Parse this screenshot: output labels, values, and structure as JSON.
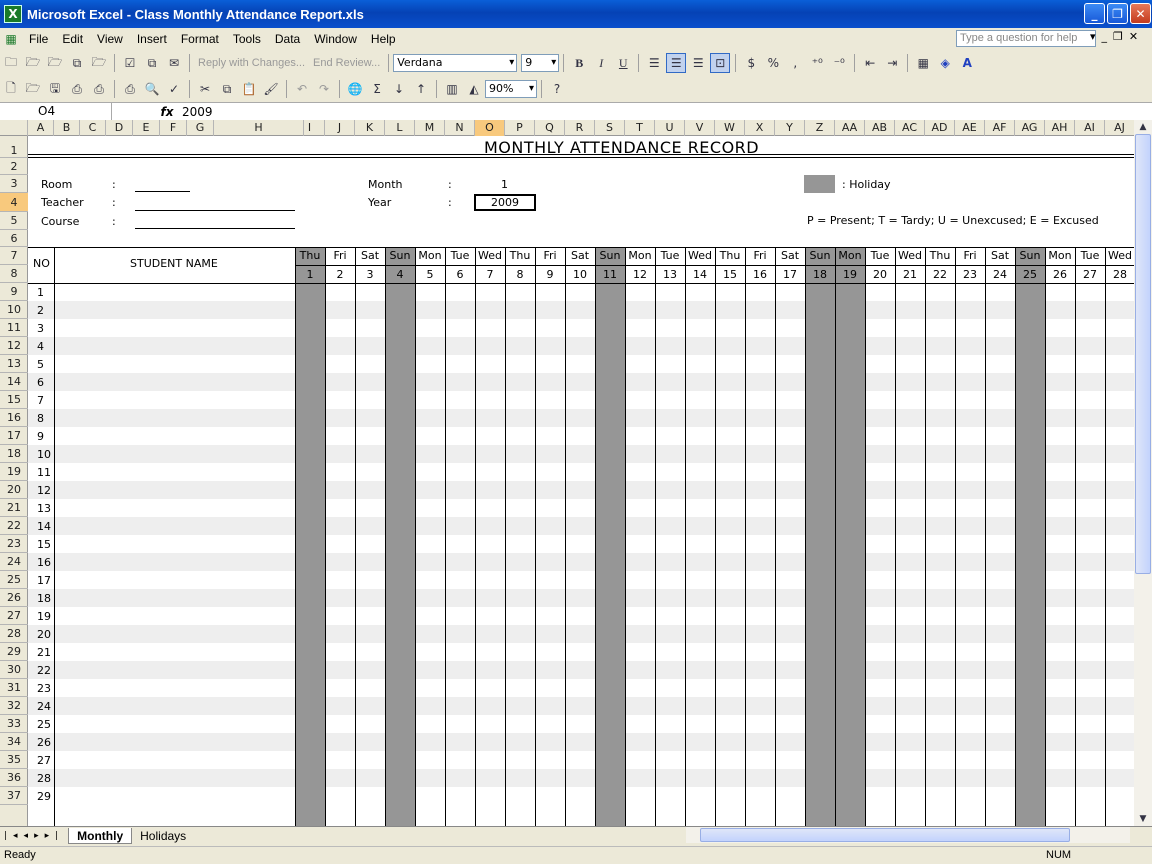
{
  "window": {
    "title": "Microsoft Excel - Class Monthly Attendance Report.xls",
    "min": "_",
    "restore": "❐",
    "close": "✕"
  },
  "menu": [
    "File",
    "Edit",
    "View",
    "Insert",
    "Format",
    "Tools",
    "Data",
    "Window",
    "Help"
  ],
  "help_placeholder": "Type a question for help",
  "toolbar": {
    "reply": "Reply with Changes...",
    "end_review": "End Review...",
    "font": "Verdana",
    "size": "9",
    "zoom": "90%",
    "bold": "B",
    "italic": "I",
    "underline": "U",
    "currency": "$",
    "percent": "%",
    "comma": ","
  },
  "formula": {
    "namebox": "O4",
    "fx": "fx",
    "value": "2009"
  },
  "columns": [
    "A",
    "B",
    "C",
    "D",
    "E",
    "F",
    "G",
    "H",
    "I",
    "J",
    "K",
    "L",
    "M",
    "N",
    "O",
    "P",
    "Q",
    "R",
    "S",
    "T",
    "U",
    "V",
    "W",
    "X",
    "Y",
    "Z",
    "AA",
    "AB",
    "AC",
    "AD",
    "AE",
    "AF",
    "AG",
    "AH",
    "AI",
    "AJ"
  ],
  "rows": [
    "1",
    "2",
    "3",
    "4",
    "5",
    "6",
    "7",
    "8",
    "9",
    "10",
    "11",
    "12",
    "13",
    "14",
    "15",
    "16",
    "17",
    "18",
    "19",
    "20",
    "21",
    "22",
    "23",
    "24",
    "25",
    "26",
    "27",
    "28",
    "29",
    "30",
    "31",
    "32",
    "33",
    "34",
    "35",
    "36",
    "37"
  ],
  "sheet": {
    "title": "MONTHLY ATTENDANCE RECORD",
    "room_label": "Room",
    "teacher_label": "Teacher",
    "course_label": "Course",
    "colon": ":",
    "month_label": "Month",
    "month_value": "1",
    "year_label": "Year",
    "year_value": "2009",
    "holiday_legend": ": Holiday",
    "codes": "P = Present; T = Tardy; U = Unexcused; E = Excused",
    "no_header": "NO",
    "name_header": "STUDENT NAME",
    "days": [
      {
        "dow": "Thu",
        "d": "1",
        "hol": true
      },
      {
        "dow": "Fri",
        "d": "2",
        "hol": false
      },
      {
        "dow": "Sat",
        "d": "3",
        "hol": false
      },
      {
        "dow": "Sun",
        "d": "4",
        "hol": true
      },
      {
        "dow": "Mon",
        "d": "5",
        "hol": false
      },
      {
        "dow": "Tue",
        "d": "6",
        "hol": false
      },
      {
        "dow": "Wed",
        "d": "7",
        "hol": false
      },
      {
        "dow": "Thu",
        "d": "8",
        "hol": false
      },
      {
        "dow": "Fri",
        "d": "9",
        "hol": false
      },
      {
        "dow": "Sat",
        "d": "10",
        "hol": false
      },
      {
        "dow": "Sun",
        "d": "11",
        "hol": true
      },
      {
        "dow": "Mon",
        "d": "12",
        "hol": false
      },
      {
        "dow": "Tue",
        "d": "13",
        "hol": false
      },
      {
        "dow": "Wed",
        "d": "14",
        "hol": false
      },
      {
        "dow": "Thu",
        "d": "15",
        "hol": false
      },
      {
        "dow": "Fri",
        "d": "16",
        "hol": false
      },
      {
        "dow": "Sat",
        "d": "17",
        "hol": false
      },
      {
        "dow": "Sun",
        "d": "18",
        "hol": true
      },
      {
        "dow": "Mon",
        "d": "19",
        "hol": true
      },
      {
        "dow": "Tue",
        "d": "20",
        "hol": false
      },
      {
        "dow": "Wed",
        "d": "21",
        "hol": false
      },
      {
        "dow": "Thu",
        "d": "22",
        "hol": false
      },
      {
        "dow": "Fri",
        "d": "23",
        "hol": false
      },
      {
        "dow": "Sat",
        "d": "24",
        "hol": false
      },
      {
        "dow": "Sun",
        "d": "25",
        "hol": true
      },
      {
        "dow": "Mon",
        "d": "26",
        "hol": false
      },
      {
        "dow": "Tue",
        "d": "27",
        "hol": false
      },
      {
        "dow": "Wed",
        "d": "28",
        "hol": false
      }
    ],
    "students": [
      "1",
      "2",
      "3",
      "4",
      "5",
      "6",
      "7",
      "8",
      "9",
      "10",
      "11",
      "12",
      "13",
      "14",
      "15",
      "16",
      "17",
      "18",
      "19",
      "20",
      "21",
      "22",
      "23",
      "24",
      "25",
      "26",
      "27",
      "28",
      "29"
    ]
  },
  "tabs": [
    "Monthly",
    "Holidays"
  ],
  "status": {
    "left": "Ready",
    "right": "NUM"
  }
}
